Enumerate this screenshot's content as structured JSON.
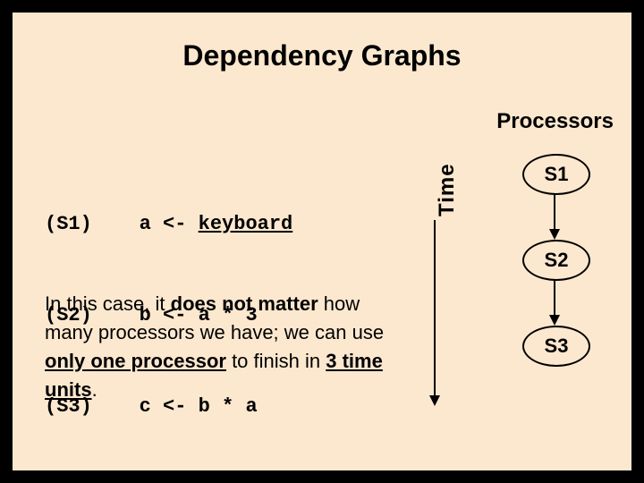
{
  "title": "Dependency Graphs",
  "labels": {
    "processors": "Processors",
    "time": "Time"
  },
  "code": {
    "s1": {
      "tag": "(S1)",
      "lhs": "a",
      "op": "<-",
      "rhs_underlined": "keyboard"
    },
    "s2": {
      "tag": "(S2)",
      "lhs": "b",
      "op": "<-",
      "rhs": "a * 3"
    },
    "s3": {
      "tag": "(S3)",
      "lhs": "c",
      "op": "<-",
      "rhs": "b * a"
    }
  },
  "paragraph": {
    "pre": "In this case, it ",
    "bold1": "does not matter",
    "mid1": " how many processors we have; we can use ",
    "under1": "only one processor",
    "mid2": " to finish in ",
    "under2": "3 time units",
    "post": "."
  },
  "nodes": {
    "n1": "S1",
    "n2": "S2",
    "n3": "S3"
  },
  "chart_data": {
    "type": "diagram",
    "title": "Dependency Graphs",
    "axis_label": "Time",
    "column_header": "Processors",
    "statements": [
      {
        "id": "S1",
        "code": "a <- keyboard"
      },
      {
        "id": "S2",
        "code": "b <- a * 3"
      },
      {
        "id": "S3",
        "code": "c <- b * a"
      }
    ],
    "nodes": [
      "S1",
      "S2",
      "S3"
    ],
    "edges": [
      {
        "from": "S1",
        "to": "S2"
      },
      {
        "from": "S2",
        "to": "S3"
      }
    ],
    "min_processors": 1,
    "time_units": 3
  }
}
